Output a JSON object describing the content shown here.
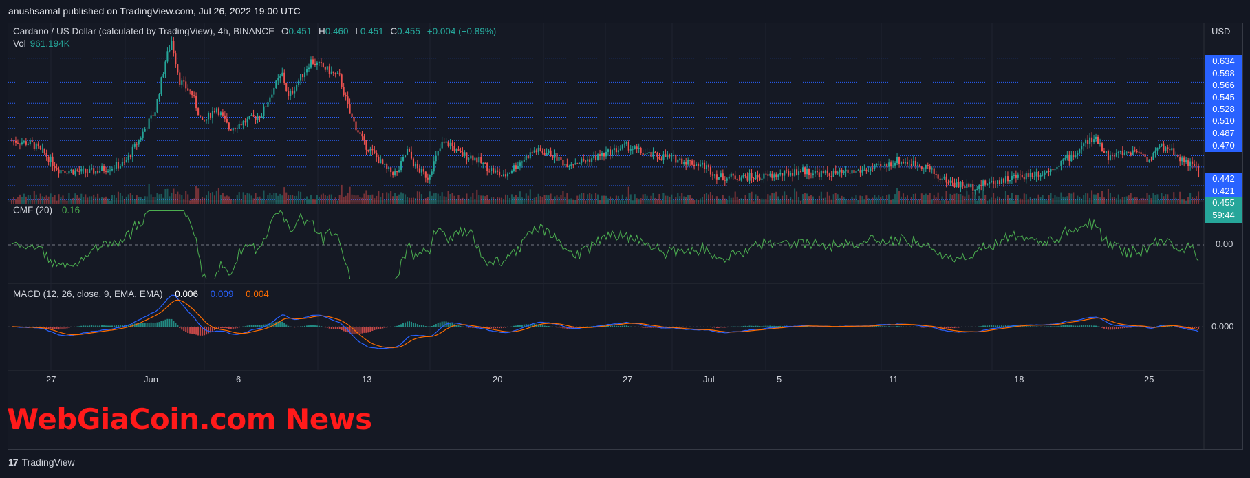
{
  "header": {
    "text": "anushsamal published on TradingView.com, Jul 26, 2022 19:00 UTC"
  },
  "legend": {
    "symbol": "Cardano / US Dollar (calculated by TradingView), 4h, BINANCE",
    "o_label": "O",
    "o_value": "0.451",
    "h_label": "H",
    "h_value": "0.460",
    "l_label": "L",
    "l_value": "0.451",
    "c_label": "C",
    "c_value": "0.455",
    "change": "+0.004 (+0.89%)",
    "vol_label": "Vol",
    "vol_value": "961.194K",
    "cmf_label": "CMF (20)",
    "cmf_value": "−0.16",
    "macd_label": "MACD (12, 26, close, 9, EMA, EMA)",
    "macd_value": "−0.006",
    "signal_value": "−0.009",
    "hist_value": "−0.004"
  },
  "axis": {
    "currency": "USD",
    "price_levels": [
      "0.634",
      "0.598",
      "0.566",
      "0.545",
      "0.528",
      "0.510",
      "0.487",
      "0.470",
      "0.442",
      "0.421"
    ],
    "current_price": "0.455",
    "countdown": "59:44",
    "cmf_zero": "0.00",
    "macd_zero": "0.000",
    "x_ticks": [
      "27",
      "Jun",
      "6",
      "13",
      "20",
      "27",
      "Jul",
      "5",
      "11",
      "18",
      "25"
    ]
  },
  "watermark": {
    "text": "WebGiaCoin.com News"
  },
  "footer": {
    "logo": "17",
    "brand": "TradingView"
  },
  "colors": {
    "up": "#26a69a",
    "down": "#ef5350",
    "cmf": "#4caf50",
    "macd": "#2962ff",
    "signal": "#ff6d00",
    "grid_level": "#2962ff"
  },
  "chart_data": {
    "type": "candlestick",
    "symbol": "ADAUSD",
    "interval": "4h",
    "ylim": [
      0.415,
      0.645
    ],
    "price_levels": [
      0.634,
      0.598,
      0.566,
      0.545,
      0.528,
      0.51,
      0.487,
      0.47,
      0.442,
      0.421
    ],
    "current_price": 0.455,
    "last_candle": {
      "open": 0.451,
      "high": 0.46,
      "low": 0.451,
      "close": 0.455
    },
    "price_path": [
      [
        0,
        0.51
      ],
      [
        10,
        0.505
      ],
      [
        16,
        0.49
      ],
      [
        23,
        0.466
      ],
      [
        38,
        0.462
      ],
      [
        55,
        0.475
      ],
      [
        60,
        0.5
      ],
      [
        70,
        0.555
      ],
      [
        75,
        0.63
      ],
      [
        78,
        0.66
      ],
      [
        82,
        0.6
      ],
      [
        88,
        0.58
      ],
      [
        93,
        0.535
      ],
      [
        100,
        0.56
      ],
      [
        106,
        0.528
      ],
      [
        115,
        0.54
      ],
      [
        122,
        0.55
      ],
      [
        128,
        0.59
      ],
      [
        132,
        0.61
      ],
      [
        135,
        0.575
      ],
      [
        140,
        0.6
      ],
      [
        146,
        0.63
      ],
      [
        152,
        0.62
      ],
      [
        160,
        0.605
      ],
      [
        165,
        0.55
      ],
      [
        172,
        0.505
      ],
      [
        178,
        0.485
      ],
      [
        183,
        0.465
      ],
      [
        188,
        0.46
      ],
      [
        193,
        0.495
      ],
      [
        197,
        0.47
      ],
      [
        203,
        0.455
      ],
      [
        210,
        0.505
      ],
      [
        214,
        0.505
      ],
      [
        218,
        0.49
      ],
      [
        225,
        0.485
      ],
      [
        232,
        0.47
      ],
      [
        240,
        0.455
      ],
      [
        245,
        0.47
      ],
      [
        255,
        0.495
      ],
      [
        263,
        0.49
      ],
      [
        270,
        0.475
      ],
      [
        280,
        0.48
      ],
      [
        290,
        0.49
      ],
      [
        300,
        0.502
      ],
      [
        310,
        0.488
      ],
      [
        320,
        0.485
      ],
      [
        330,
        0.478
      ],
      [
        338,
        0.472
      ],
      [
        345,
        0.455
      ],
      [
        355,
        0.455
      ],
      [
        365,
        0.455
      ],
      [
        375,
        0.458
      ],
      [
        385,
        0.465
      ],
      [
        395,
        0.46
      ],
      [
        405,
        0.46
      ],
      [
        415,
        0.465
      ],
      [
        425,
        0.47
      ],
      [
        432,
        0.48
      ],
      [
        440,
        0.475
      ],
      [
        446,
        0.472
      ],
      [
        452,
        0.455
      ],
      [
        460,
        0.445
      ],
      [
        468,
        0.44
      ],
      [
        475,
        0.445
      ],
      [
        485,
        0.452
      ],
      [
        495,
        0.458
      ],
      [
        505,
        0.463
      ],
      [
        512,
        0.478
      ],
      [
        519,
        0.49
      ],
      [
        525,
        0.51
      ],
      [
        530,
        0.51
      ],
      [
        535,
        0.485
      ],
      [
        540,
        0.49
      ],
      [
        545,
        0.492
      ],
      [
        550,
        0.495
      ],
      [
        555,
        0.48
      ],
      [
        560,
        0.5
      ],
      [
        565,
        0.498
      ],
      [
        570,
        0.483
      ],
      [
        575,
        0.475
      ],
      [
        579,
        0.465
      ]
    ],
    "cmf": {
      "zero": 0.0,
      "last": -0.16
    },
    "macd": {
      "zero": 0.0,
      "macd": -0.006,
      "signal": -0.009,
      "histogram": -0.004
    }
  }
}
